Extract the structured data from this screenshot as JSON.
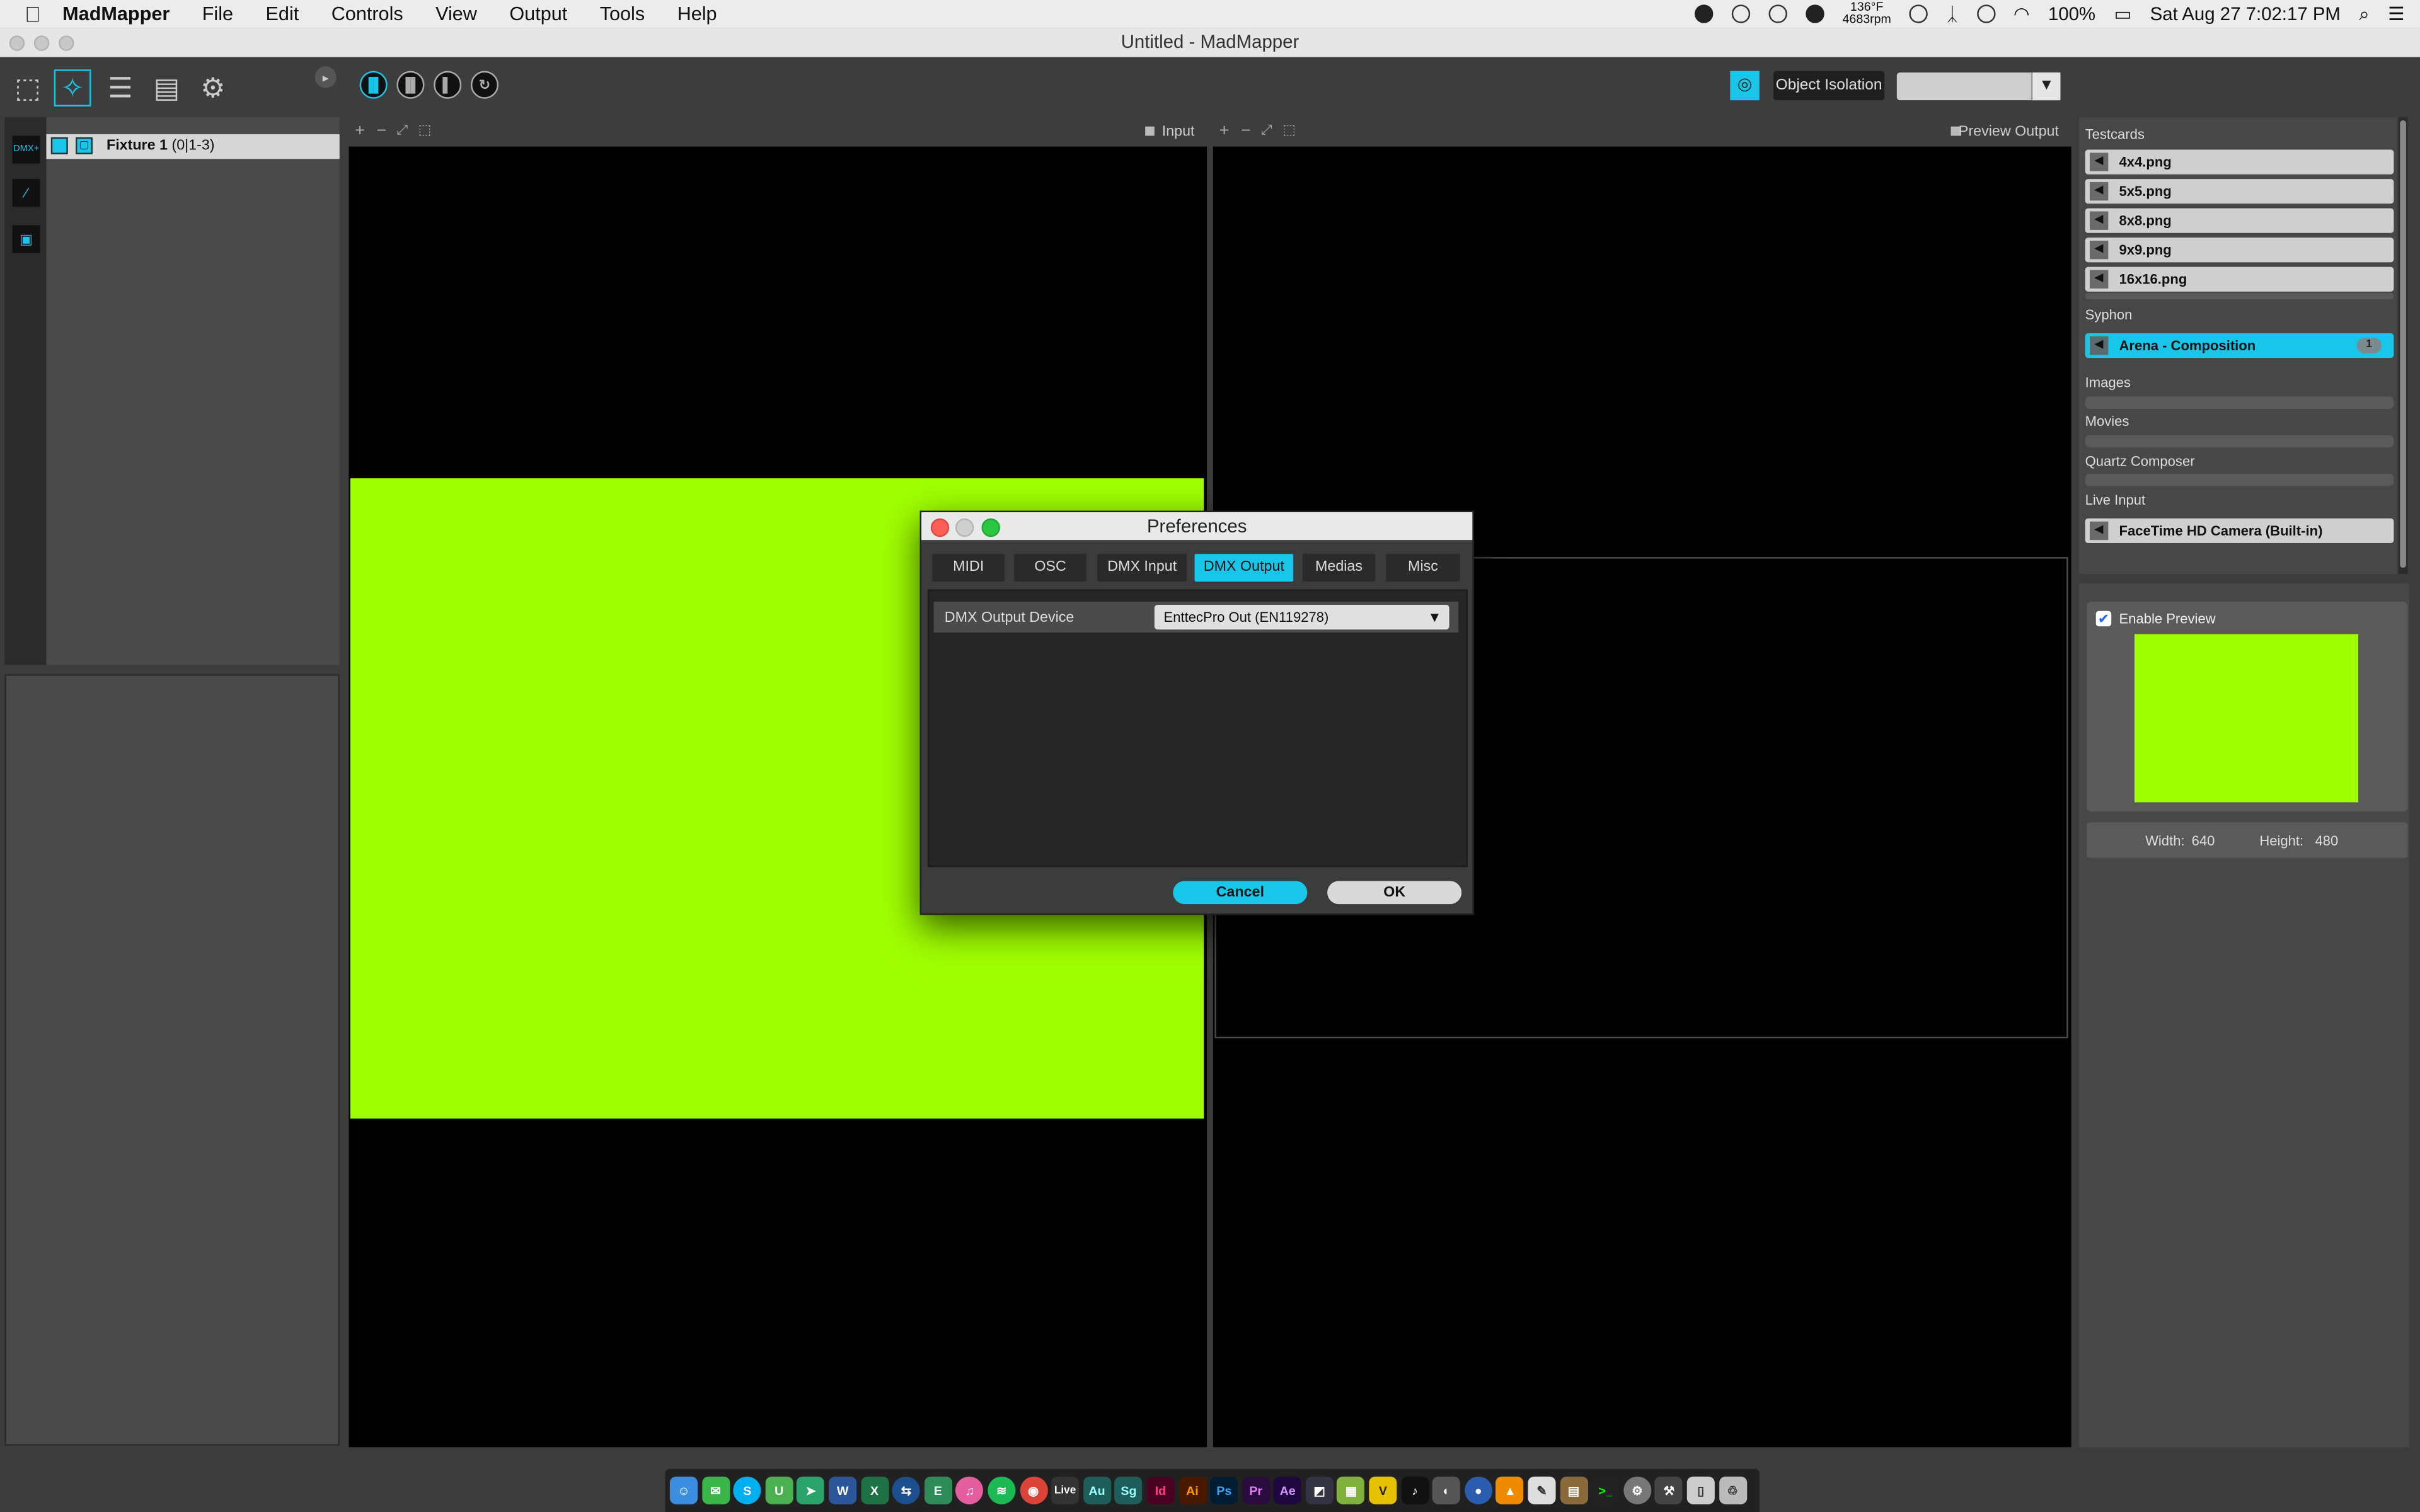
{
  "menubar": {
    "app_name": "MadMapper",
    "items": [
      "File",
      "Edit",
      "Controls",
      "View",
      "Output",
      "Tools",
      "Help"
    ],
    "temp_line1": "136°F",
    "temp_line2": "4683rpm",
    "battery": "100%",
    "clock": "Sat Aug 27  7:02:17 PM"
  },
  "window": {
    "title": "Untitled - MadMapper"
  },
  "toolbar": {
    "object_isolation": "Object Isolation"
  },
  "left_panel": {
    "fixture_name": "Fixture 1",
    "fixture_addr": "(0|1-3)"
  },
  "viewports": {
    "input_label": "Input",
    "output_label": "Preview Output"
  },
  "library": {
    "testcards_label": "Testcards",
    "testcards": [
      "4x4.png",
      "5x5.png",
      "8x8.png",
      "9x9.png",
      "16x16.png"
    ],
    "syphon_label": "Syphon",
    "syphon_item": "Arena - Composition",
    "syphon_badge": "1",
    "images_label": "Images",
    "movies_label": "Movies",
    "qc_label": "Quartz Composer",
    "live_label": "Live Input",
    "live_item": "FaceTime HD Camera (Built-in)"
  },
  "preview": {
    "enable_label": "Enable Preview",
    "enabled": true,
    "width_label": "Width:",
    "width_value": "640",
    "height_label": "Height:",
    "height_value": "480"
  },
  "dialog": {
    "title": "Preferences",
    "tabs": [
      "MIDI",
      "OSC",
      "DMX Input",
      "DMX Output",
      "Medias",
      "Misc"
    ],
    "active_tab": "DMX Output",
    "row_label": "DMX Output Device",
    "device_value": "EnttecPro Out (EN119278)",
    "cancel": "Cancel",
    "ok": "OK"
  },
  "dock": {
    "labels": [
      "Live",
      "Au",
      "Sg",
      "Id",
      "Ai",
      "Ps",
      "Pr",
      "Ae",
      "V"
    ]
  },
  "colors": {
    "accent": "#17c6e8",
    "lime": "#a0ff00"
  }
}
